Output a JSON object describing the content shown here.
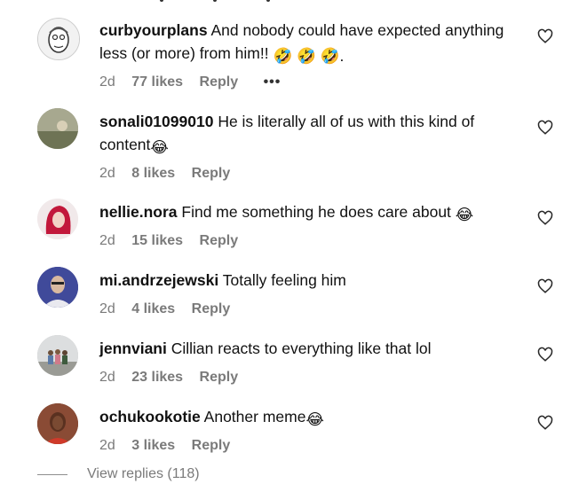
{
  "comments": [
    {
      "username": "curbyourplans",
      "text": "And nobody could have expected anything less (or more) from him!!",
      "emoji_suffix": "🤣 🤣 🤣.",
      "time": "2d",
      "likes": "77 likes",
      "reply": "Reply",
      "more": "•••",
      "avatar": "cartoon-face-avatar"
    },
    {
      "username": "sonali01099010",
      "text": "He is literally all of us with this kind of content",
      "emoji_suffix": "😂",
      "time": "2d",
      "likes": "8 likes",
      "reply": "Reply",
      "avatar": "photo-avatar"
    },
    {
      "username": "nellie.nora",
      "text": "Find me something he does care about",
      "emoji_suffix": "😂",
      "time": "2d",
      "likes": "15 likes",
      "reply": "Reply",
      "avatar": "red-hair-avatar"
    },
    {
      "username": "mi.andrzejewski",
      "text": "Totally feeling him",
      "emoji_suffix": "",
      "time": "2d",
      "likes": "4 likes",
      "reply": "Reply",
      "avatar": "man-avatar"
    },
    {
      "username": "jennviani",
      "text": "Cillian reacts to everything like that lol",
      "emoji_suffix": "",
      "time": "2d",
      "likes": "23 likes",
      "reply": "Reply",
      "avatar": "group-photo-avatar"
    },
    {
      "username": "ochukookotie",
      "text": "Another meme",
      "emoji_suffix": "😂",
      "time": "2d",
      "likes": "3 likes",
      "reply": "Reply",
      "avatar": "woman-avatar"
    }
  ],
  "view_replies": "View replies (118)",
  "colors": {
    "meta": "#7a7a7a",
    "text": "#111111"
  }
}
